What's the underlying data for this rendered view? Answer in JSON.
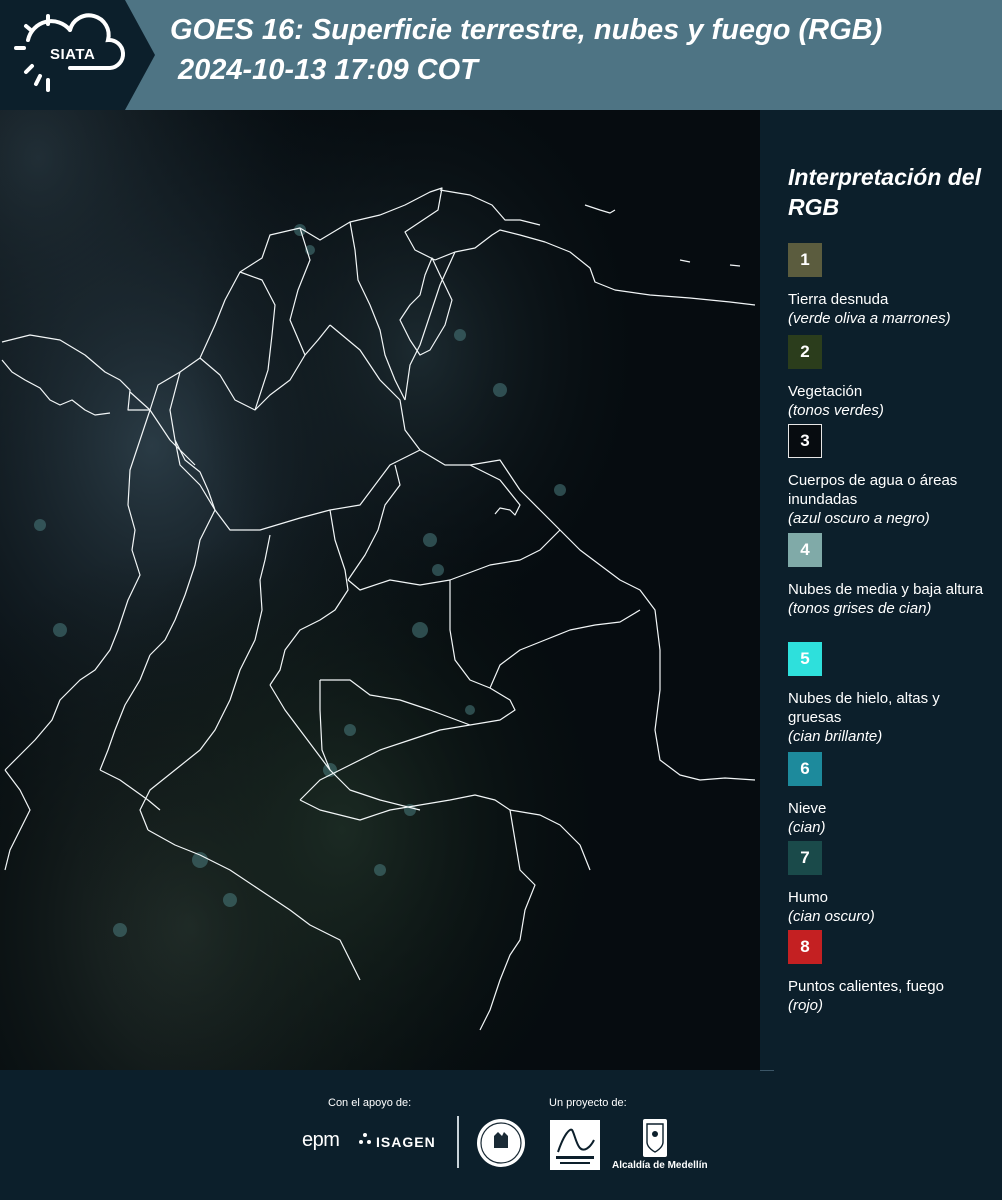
{
  "header": {
    "logo_text": "SIATA",
    "title_line1": "GOES 16: Superficie terrestre, nubes y fuego (RGB)",
    "title_line2": "2024-10-13 17:09 COT"
  },
  "legend": {
    "title": "Interpretación del RGB",
    "items": [
      {
        "number": "1",
        "label": "Tierra desnuda",
        "desc": "(verde oliva a marrones)",
        "color": "#5b5c3e"
      },
      {
        "number": "2",
        "label": "Vegetación",
        "desc": "(tonos verdes)",
        "color": "#2b3d1c"
      },
      {
        "number": "3",
        "label": "Cuerpos de agua o áreas inundadas",
        "desc": "(azul oscuro a negro)",
        "color": "#070c10"
      },
      {
        "number": "4",
        "label": "Nubes de media y baja altura",
        "desc": "(tonos grises de cian)",
        "color": "#80aaa8"
      },
      {
        "number": "5",
        "label": "Nubes de hielo, altas y gruesas",
        "desc": "(cian brillante)",
        "color": "#2ee0dc"
      },
      {
        "number": "6",
        "label": "Nieve",
        "desc": "(cian)",
        "color": "#1d8a9c"
      },
      {
        "number": "7",
        "label": "Humo",
        "desc": "(cian oscuro)",
        "color": "#1a4a4a"
      },
      {
        "number": "8",
        "label": "Puntos calientes, fuego",
        "desc": "(rojo)",
        "color": "#c42022"
      }
    ]
  },
  "footer": {
    "support_label": "Con el apoyo de:",
    "project_label": "Un proyecto de:",
    "sponsor_1": "epm",
    "sponsor_2": "ISAGEN",
    "partner_label": "Alcaldía de Medellín"
  }
}
